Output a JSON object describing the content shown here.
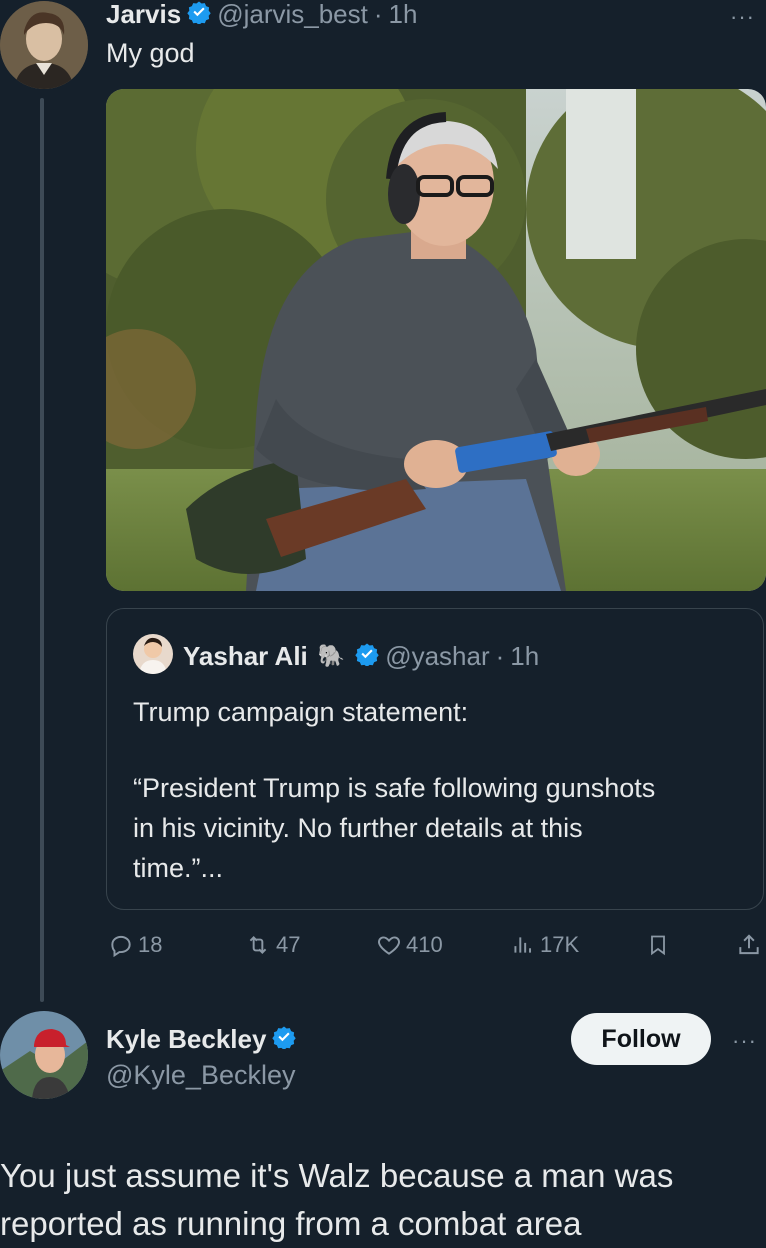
{
  "main_tweet": {
    "author_name": "Jarvis",
    "author_handle": "@jarvis_best",
    "separator": "·",
    "time": "1h",
    "text": "My god",
    "more_label": "···"
  },
  "quoted_tweet": {
    "author_name": "Yashar Ali",
    "author_emoji": "🐘",
    "author_handle": "@yashar",
    "separator": "·",
    "time": "1h",
    "line1": "Trump campaign statement:",
    "line2": "“President Trump is safe following gunshots",
    "line3": "in his vicinity. No further details at this",
    "line4": "time.”..."
  },
  "actions": {
    "replies": "18",
    "reposts": "47",
    "likes": "410",
    "views": "17K"
  },
  "reply_tweet": {
    "author_name": "Kyle Beckley",
    "author_handle": "@Kyle_Beckley",
    "follow_label": "Follow",
    "more_label": "···",
    "line1": "You just assume it's Walz because a man was",
    "line2": "reported as running from a combat area"
  },
  "colors": {
    "background": "#15202b",
    "verified": "#1d9bf0",
    "muted": "#8b98a5"
  }
}
